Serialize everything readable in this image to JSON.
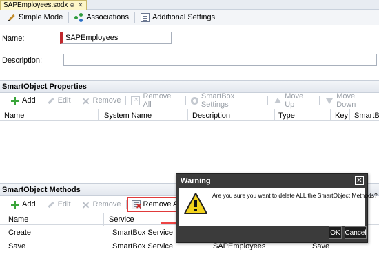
{
  "tab": {
    "title": "SAPEmployees.sodx",
    "pin": "⊕",
    "close": "✕"
  },
  "toolbar": {
    "simple_mode": "Simple Mode",
    "associations": "Associations",
    "additional_settings": "Additional Settings"
  },
  "form": {
    "name_label": "Name:",
    "name_value": "SAPEmployees",
    "description_label": "Description:",
    "description_value": ""
  },
  "properties": {
    "header": "SmartObject Properties",
    "buttons": {
      "add": "Add",
      "edit": "Edit",
      "remove": "Remove",
      "remove_all": "Remove All",
      "smartbox_settings": "SmartBox Settings",
      "move_up": "Move Up",
      "move_down": "Move Down"
    },
    "columns": [
      "Name",
      "System Name",
      "Description",
      "Type",
      "Key",
      "SmartBo"
    ]
  },
  "methods": {
    "header": "SmartObject Methods",
    "buttons": {
      "add": "Add",
      "edit": "Edit",
      "remove": "Remove",
      "remove_all": "Remove All"
    },
    "columns": [
      "Name",
      "Service"
    ],
    "rows": [
      {
        "name": "Create",
        "service": "SmartBox Service",
        "extra": "",
        "type": ""
      },
      {
        "name": "Save",
        "service": "SmartBox Service",
        "extra": "SAPEmployees",
        "type": "Save"
      }
    ]
  },
  "dialog": {
    "title": "Warning",
    "close": "✕",
    "message": "Are you sure you want to delete ALL the SmartObject Methods?",
    "ok": "OK",
    "cancel": "Cancel"
  },
  "colors": {
    "highlight": "#e03a3a",
    "dialog_bg": "#3b3b3b",
    "required_marker": "#c0282d"
  }
}
